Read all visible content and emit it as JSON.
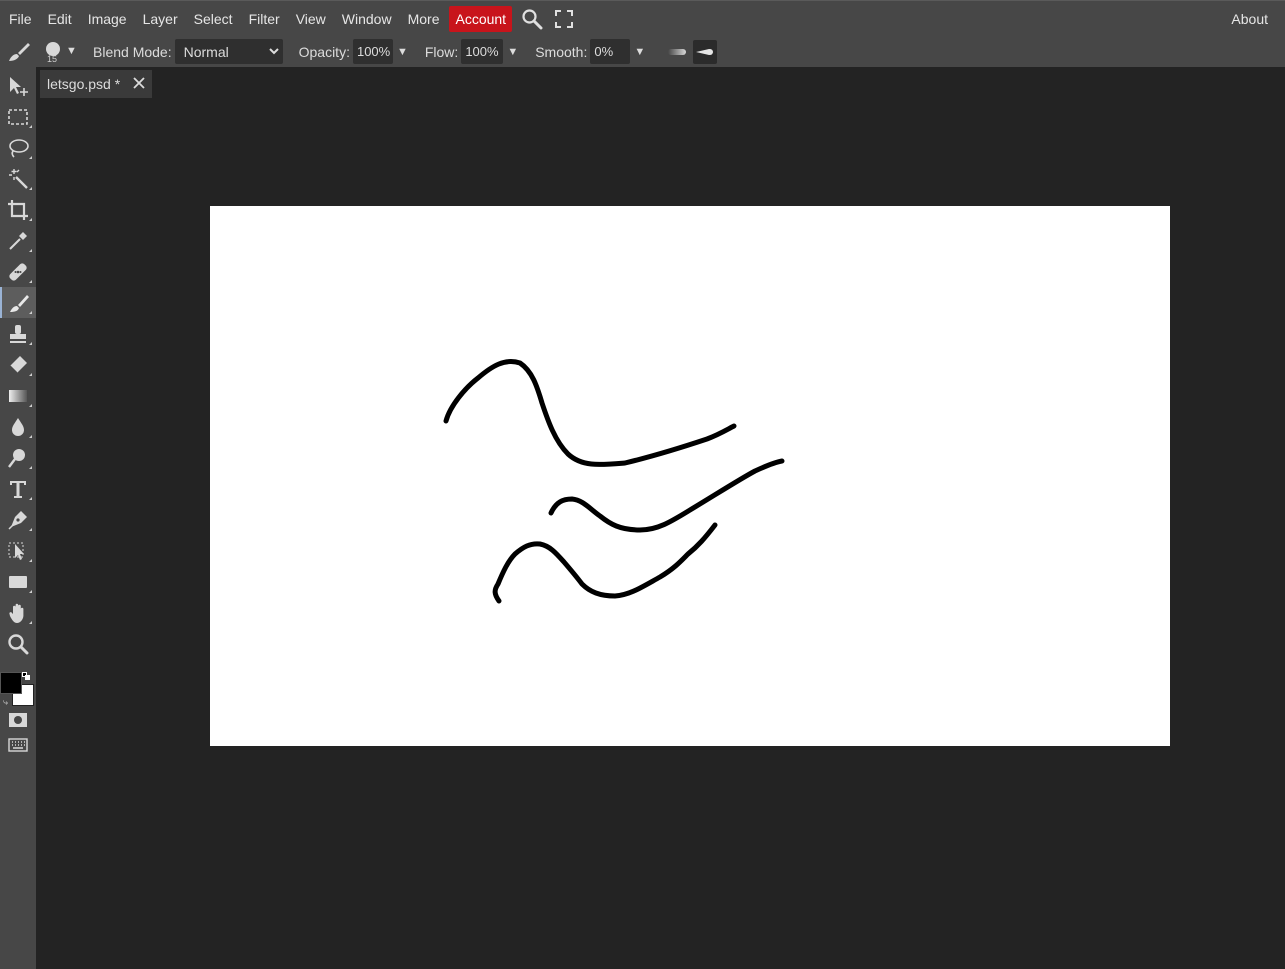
{
  "menu": {
    "items": [
      "File",
      "Edit",
      "Image",
      "Layer",
      "Select",
      "Filter",
      "View",
      "Window",
      "More"
    ],
    "account": "Account",
    "about": "About"
  },
  "options": {
    "brush_size": "15",
    "blend_label": "Blend Mode:",
    "blend_value": "Normal",
    "opacity_label": "Opacity:",
    "opacity_value": "100%",
    "flow_label": "Flow:",
    "flow_value": "100%",
    "smooth_label": "Smooth:",
    "smooth_value": "0%"
  },
  "document": {
    "tab_title": "letsgo.psd *"
  },
  "colors": {
    "foreground": "#000000",
    "background": "#ffffff",
    "account_accent": "#c8141b"
  },
  "tools": [
    "move-tool-icon",
    "marquee-tool-icon",
    "lasso-tool-icon",
    "magic-wand-tool-icon",
    "crop-tool-icon",
    "eyedropper-tool-icon",
    "healing-tool-icon",
    "brush-tool-icon",
    "clone-stamp-tool-icon",
    "eraser-tool-icon",
    "gradient-tool-icon",
    "blur-tool-icon",
    "dodge-tool-icon",
    "type-tool-icon",
    "pen-tool-icon",
    "path-select-tool-icon",
    "rectangle-tool-icon",
    "hand-tool-icon",
    "zoom-tool-icon"
  ],
  "active_tool": "brush-tool-icon"
}
